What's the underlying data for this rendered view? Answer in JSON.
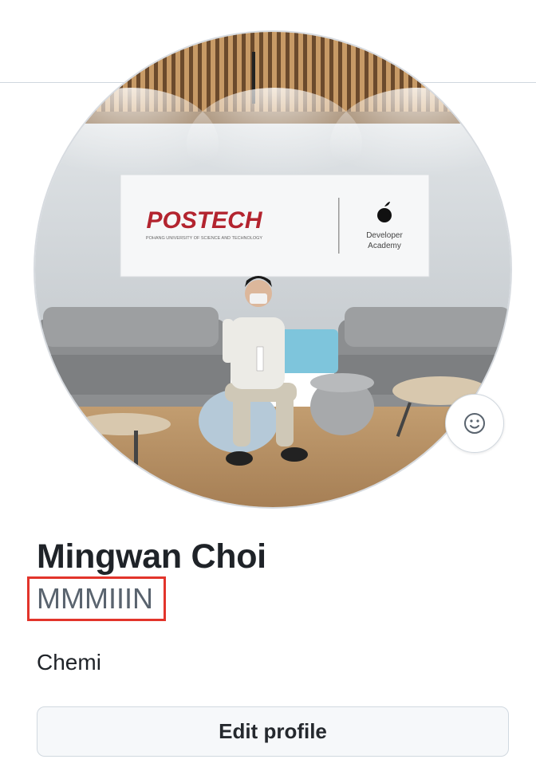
{
  "profile": {
    "display_name": "Mingwan Choi",
    "username": "MMMIIIN",
    "bio": "Chemi",
    "edit_button_label": "Edit profile"
  },
  "avatar": {
    "sign_logo": "POSTECH",
    "sign_subtitle": "POHANG UNIVERSITY OF SCIENCE AND TECHNOLOGY",
    "sign_developer_line1": "Developer",
    "sign_developer_line2": "Academy"
  },
  "icons": {
    "status": "smiley-icon"
  },
  "colors": {
    "highlight_box": "#e2342b",
    "username_text": "#59636e",
    "button_background": "#f6f8fa",
    "divider": "#d0d7de"
  }
}
